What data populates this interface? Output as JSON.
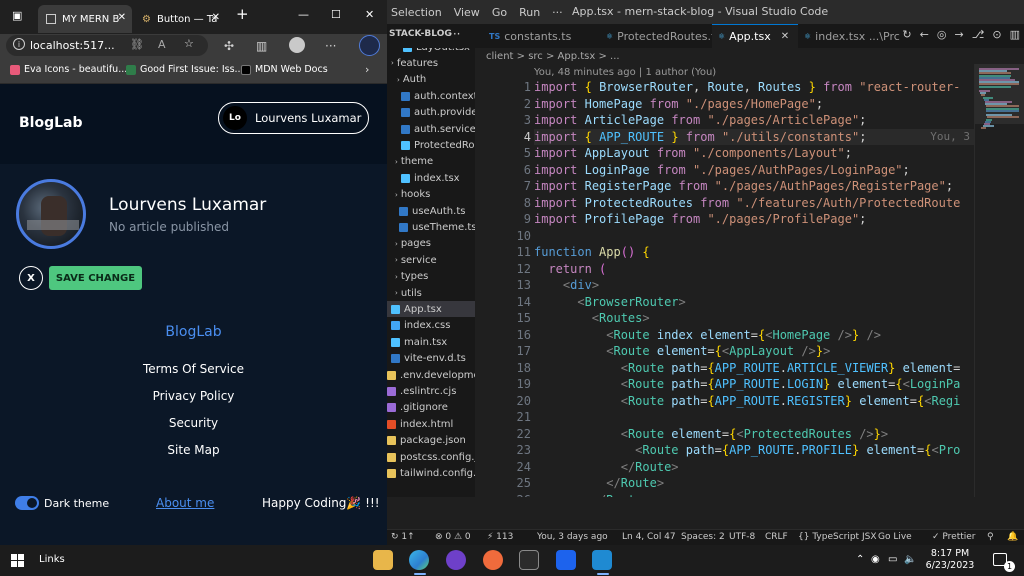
{
  "browser": {
    "tabs": [
      {
        "label": "MY MERN B",
        "active": true
      },
      {
        "label": "Button — Ta",
        "active": false
      }
    ],
    "address": "localhost:517...",
    "favorites": [
      "Eva Icons - beautifu...",
      "Good First Issue: Iss...",
      "MDN Web Docs"
    ]
  },
  "app": {
    "brand": "BlogLab",
    "user_initials": "Lo",
    "user_name": "Lourvens Luxamar",
    "profile": {
      "name": "Lourvens Luxamar",
      "subtitle": "No article published"
    },
    "x_button": "X",
    "save_label": "SAVE CHANGE",
    "footer": {
      "brand": "BlogLab",
      "links": [
        "Terms Of Service",
        "Privacy Policy",
        "Security",
        "Site Map"
      ]
    },
    "dark_theme_label": "Dark theme",
    "dark_theme_on": true,
    "about_label": "About me",
    "happy_label": "Happy Coding🎉 !!!"
  },
  "vscode": {
    "menu": [
      "Selection",
      "View",
      "Go",
      "Run",
      "···"
    ],
    "window_title": "App.tsx - mern-stack-blog - Visual Studio Code",
    "sidebar_header": "STACK-BLOG",
    "tabs": [
      {
        "label": "constants.ts",
        "active": false
      },
      {
        "label": "ProtectedRoutes.tsx",
        "active": false
      },
      {
        "label": "App.tsx",
        "active": true
      },
      {
        "label": "index.tsx ...\\Prc",
        "active": false
      }
    ],
    "explorer": [
      {
        "label": "LayOut.tsx",
        "kind": "tsx"
      },
      {
        "label": "features",
        "kind": "folder"
      },
      {
        "label": "Auth",
        "kind": "folder"
      },
      {
        "label": "auth.context.ts",
        "kind": "ts"
      },
      {
        "label": "auth.provider....",
        "kind": "ts"
      },
      {
        "label": "auth.service.ts",
        "kind": "ts"
      },
      {
        "label": "ProtectedRout...",
        "kind": "tsx"
      },
      {
        "label": "theme",
        "kind": "folder"
      },
      {
        "label": "index.tsx",
        "kind": "tsx"
      },
      {
        "label": "hooks",
        "kind": "folder"
      },
      {
        "label": "useAuth.ts",
        "kind": "ts"
      },
      {
        "label": "useTheme.ts",
        "kind": "ts"
      },
      {
        "label": "pages",
        "kind": "folder"
      },
      {
        "label": "service",
        "kind": "folder"
      },
      {
        "label": "types",
        "kind": "folder"
      },
      {
        "label": "utils",
        "kind": "folder"
      },
      {
        "label": "App.tsx",
        "kind": "tsx"
      },
      {
        "label": "index.css",
        "kind": "css"
      },
      {
        "label": "main.tsx",
        "kind": "tsx"
      },
      {
        "label": "vite-env.d.ts",
        "kind": "ts"
      },
      {
        "label": ".env.development",
        "kind": "env"
      },
      {
        "label": ".eslintrc.cjs",
        "kind": "cfg"
      },
      {
        "label": ".gitignore",
        "kind": "cfg"
      },
      {
        "label": "index.html",
        "kind": "html"
      },
      {
        "label": "package.json",
        "kind": "json"
      },
      {
        "label": "postcss.config.js",
        "kind": "js"
      },
      {
        "label": "tailwind.config.js",
        "kind": "js"
      }
    ],
    "breadcrumb": "client > src > App.tsx > ...",
    "blame_top": "You, 48 minutes ago | 1 author (You)",
    "inline_blame": "You, 3",
    "current_line": 4,
    "code_lines": [
      "import { BrowserRouter, Route, Routes } from \"react-router-",
      "import HomePage from \"./pages/HomePage\";",
      "import ArticlePage from \"./pages/ArticlePage\";",
      "import { APP_ROUTE } from \"./utils/constants\";",
      "import AppLayout from \"./components/Layout\";",
      "import LoginPage from \"./pages/AuthPages/LoginPage\";",
      "import RegisterPage from \"./pages/AuthPages/RegisterPage\";",
      "import ProtectedRoutes from \"./features/Auth/ProtectedRoute",
      "import ProfilePage from \"./pages/ProfilePage\";",
      "",
      "function App() {",
      "  return (",
      "    <div>",
      "      <BrowserRouter>",
      "        <Routes>",
      "          <Route index element={<HomePage />} />",
      "          <Route element={<AppLayout />}>",
      "            <Route path={APP_ROUTE.ARTICLE_VIEWER} element=",
      "            <Route path={APP_ROUTE.LOGIN} element={<LoginPa",
      "            <Route path={APP_ROUTE.REGISTER} element={<Regi",
      "",
      "            <Route element={<ProtectedRoutes />}>",
      "              <Route path={APP_ROUTE.PROFILE} element={<Pro",
      "            </Route>",
      "          </Route>",
      "        </Routes>",
      "      </BrowserRouter>",
      "    </div>"
    ],
    "status": {
      "errors": "⊗ 0 ⚠ 0",
      "ports": "⚡ 113",
      "blame": "You, 3 days ago",
      "position": "Ln 4, Col 47",
      "spaces": "Spaces: 2",
      "encoding": "UTF-8",
      "eol": "CRLF",
      "language": "{} TypeScript JSX",
      "golive": "Go Live",
      "prettier": "✓ Prettier"
    }
  },
  "taskbar": {
    "links_label": "Links",
    "time": "8:17 PM",
    "date": "6/23/2023",
    "notifications": "1"
  }
}
